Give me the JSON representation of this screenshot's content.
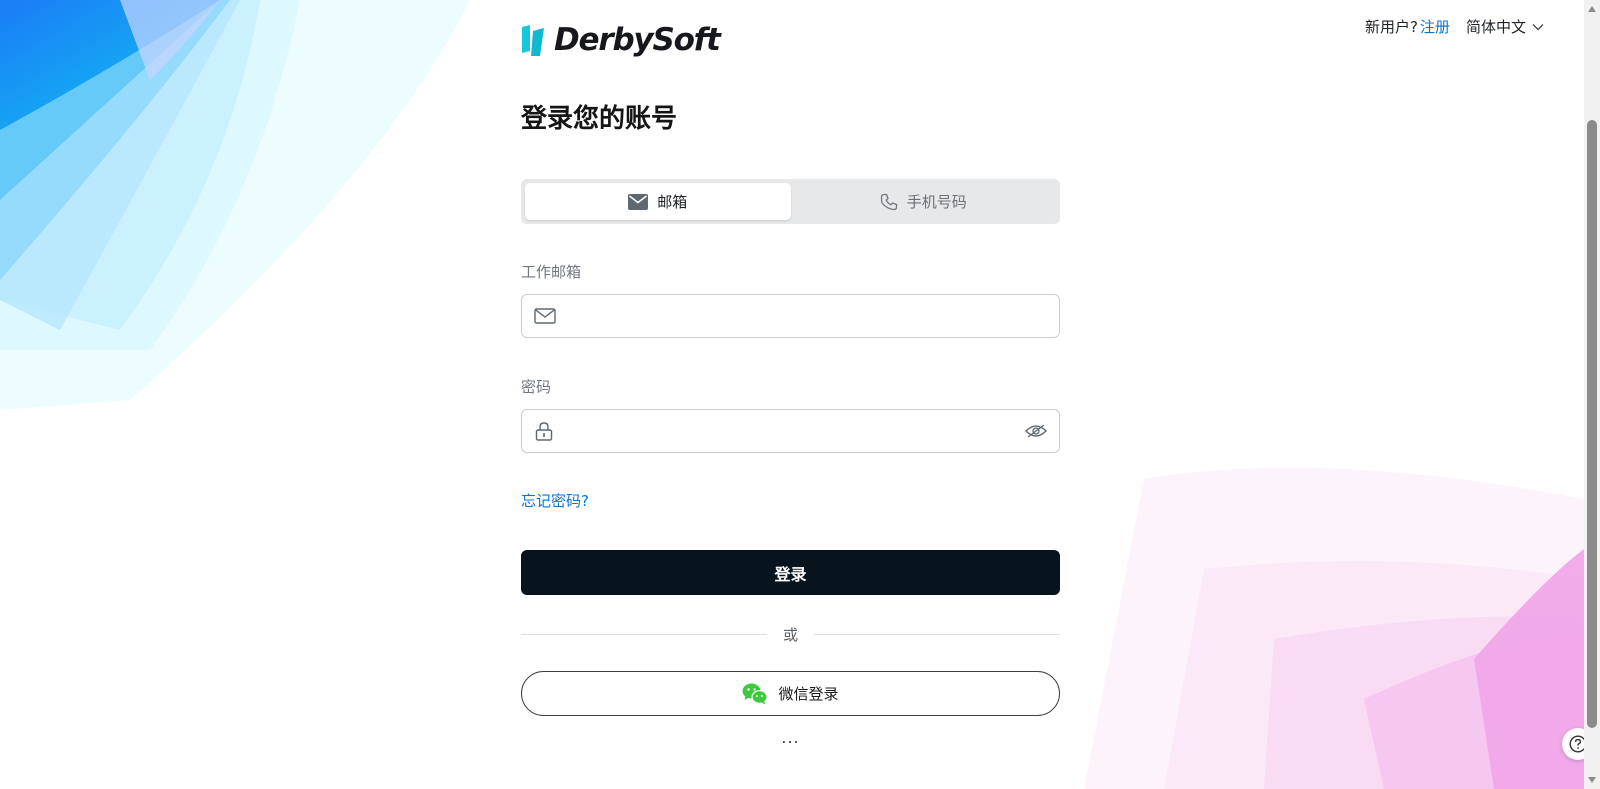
{
  "brand": {
    "name": "DerbySoft"
  },
  "top_bar": {
    "new_user_text": "新用户?",
    "register_link": "注册",
    "language": "简体中文"
  },
  "form": {
    "heading": "登录您的账号",
    "tabs": [
      {
        "label": "邮箱",
        "icon": "envelope-filled-icon",
        "active": true
      },
      {
        "label": "手机号码",
        "icon": "phone-icon",
        "active": false
      }
    ],
    "email": {
      "label": "工作邮箱",
      "value": "",
      "placeholder": ""
    },
    "password": {
      "label": "密码",
      "value": "",
      "placeholder": ""
    },
    "forgot_link": "忘记密码?",
    "login_button": "登录",
    "divider_text": "或",
    "wechat_button": "微信登录",
    "more_options": "..."
  },
  "colors": {
    "accent_link": "#0b74d6",
    "primary_button": "#07141d",
    "wechat_green": "#3dc83d",
    "logo_cyan": "#17c6d9"
  }
}
